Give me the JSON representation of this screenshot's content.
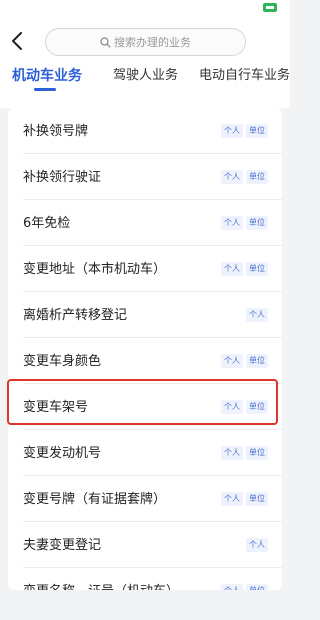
{
  "header": {
    "search_placeholder": "搜索办理的业务"
  },
  "tabs": [
    {
      "label": "机动车业务",
      "active": true
    },
    {
      "label": "驾驶人业务",
      "active": false
    },
    {
      "label": "电动自行车业务",
      "active": false
    }
  ],
  "services": [
    {
      "label": "补换领号牌",
      "tags": [
        "个人",
        "单位"
      ]
    },
    {
      "label": "补换领行驶证",
      "tags": [
        "个人",
        "单位"
      ]
    },
    {
      "label": "6年免检",
      "tags": [
        "个人",
        "单位"
      ]
    },
    {
      "label": "变更地址（本市机动车）",
      "tags": [
        "个人",
        "单位"
      ]
    },
    {
      "label": "离婚析产转移登记",
      "tags": [
        "个人"
      ]
    },
    {
      "label": "变更车身颜色",
      "tags": [
        "个人",
        "单位"
      ]
    },
    {
      "label": "变更车架号",
      "tags": [
        "个人",
        "单位"
      ]
    },
    {
      "label": "变更发动机号",
      "tags": [
        "个人",
        "单位"
      ]
    },
    {
      "label": "变更号牌（有证据套牌）",
      "tags": [
        "个人",
        "单位"
      ]
    },
    {
      "label": "夫妻变更登记",
      "tags": [
        "个人"
      ]
    },
    {
      "label": "变更名称、证号（机动车）",
      "tags": [
        "个人",
        "单位"
      ]
    }
  ],
  "highlighted_service": "变更车架号",
  "colors": {
    "accent": "#2c5fd8",
    "highlight": "#e0342b",
    "tag_text": "#4a6fd0",
    "tag_bg": "#eef2fc"
  }
}
